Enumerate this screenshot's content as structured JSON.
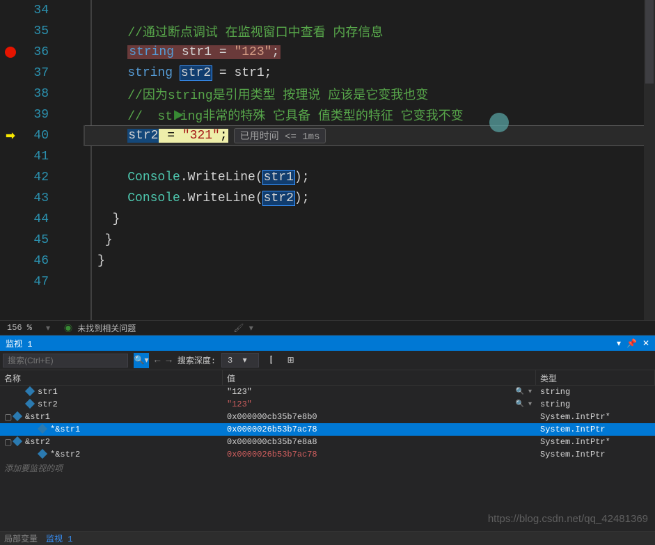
{
  "lines": [
    {
      "num": "34",
      "margin": "",
      "html": ""
    },
    {
      "num": "35",
      "margin": "",
      "html": "    <span class='comment'>//通过断点调试 在监视窗口中查看 内存信息</span>"
    },
    {
      "num": "36",
      "margin": "bp",
      "html": "    <span class='hl1'><span class='kw'>string</span> str1 = <span class='str'>\"123\"</span>;</span>"
    },
    {
      "num": "37",
      "margin": "",
      "html": "    <span class='kw'>string</span> <span class='hl2'>str2</span> = str1;"
    },
    {
      "num": "38",
      "margin": "",
      "html": "    <span class='comment'>//因为string是引用类型 按理说 应该是它变我也变</span>"
    },
    {
      "num": "39",
      "margin": "play",
      "html": "    <span class='comment'>//  string非常的特殊 它具备 值类型的特征 它变我不变</span>"
    },
    {
      "num": "40",
      "margin": "cur",
      "html": "    <span class='hl3'>str2</span><span class='hl4'> = <span style='color:#a31515'>\"321\"</span>;</span>",
      "perf": "已用时间 <= 1ms",
      "current": true,
      "cursor": true
    },
    {
      "num": "41",
      "margin": "",
      "html": ""
    },
    {
      "num": "42",
      "margin": "",
      "html": "    <span class='cls'>Console</span>.WriteLine(<span class='hl2'>str1</span>);"
    },
    {
      "num": "43",
      "margin": "",
      "html": "    <span class='cls'>Console</span>.WriteLine(<span class='hl2'>str2</span>);"
    },
    {
      "num": "44",
      "margin": "",
      "html": "  }"
    },
    {
      "num": "45",
      "margin": "",
      "html": " }"
    },
    {
      "num": "46",
      "margin": "",
      "html": "}"
    },
    {
      "num": "47",
      "margin": "",
      "html": ""
    }
  ],
  "status": {
    "zoom": "156 %",
    "issues": "未找到相关问题"
  },
  "panel": {
    "title": "监视 1"
  },
  "toolbar": {
    "searchPlaceholder": "搜索(Ctrl+E)",
    "depthLabel": "搜索深度:",
    "depth": "3"
  },
  "watch": {
    "headers": {
      "name": "名称",
      "value": "值",
      "type": "类型"
    },
    "rows": [
      {
        "indent": 1,
        "expander": "",
        "icon": "blue",
        "name": "str1",
        "value": "\"123\"",
        "type": "string",
        "magnify": true
      },
      {
        "indent": 1,
        "expander": "",
        "icon": "blue",
        "name": "str2",
        "value": "\"123\"",
        "type": "string",
        "changed": true,
        "magnify": true
      },
      {
        "indent": 0,
        "expander": "▢",
        "icon": "blue",
        "name": "&str1",
        "value": "0x000000cb35b7e8b0",
        "type": "System.IntPtr*"
      },
      {
        "indent": 2,
        "expander": "",
        "icon": "blue",
        "name": "*&str1",
        "value": "0x0000026b53b7ac78",
        "type": "System.IntPtr",
        "selected": true
      },
      {
        "indent": 0,
        "expander": "▢",
        "icon": "blue",
        "name": "&str2",
        "value": "0x000000cb35b7e8a8",
        "type": "System.IntPtr*"
      },
      {
        "indent": 2,
        "expander": "",
        "icon": "blue",
        "name": "*&str2",
        "value": "0x0000026b53b7ac78",
        "type": "System.IntPtr",
        "changed": true
      }
    ],
    "addItem": "添加要监视的项"
  },
  "bottomTabs": {
    "tab1": "局部变量",
    "tab2": "监视 1"
  },
  "watermark": "https://blog.csdn.net/qq_42481369"
}
